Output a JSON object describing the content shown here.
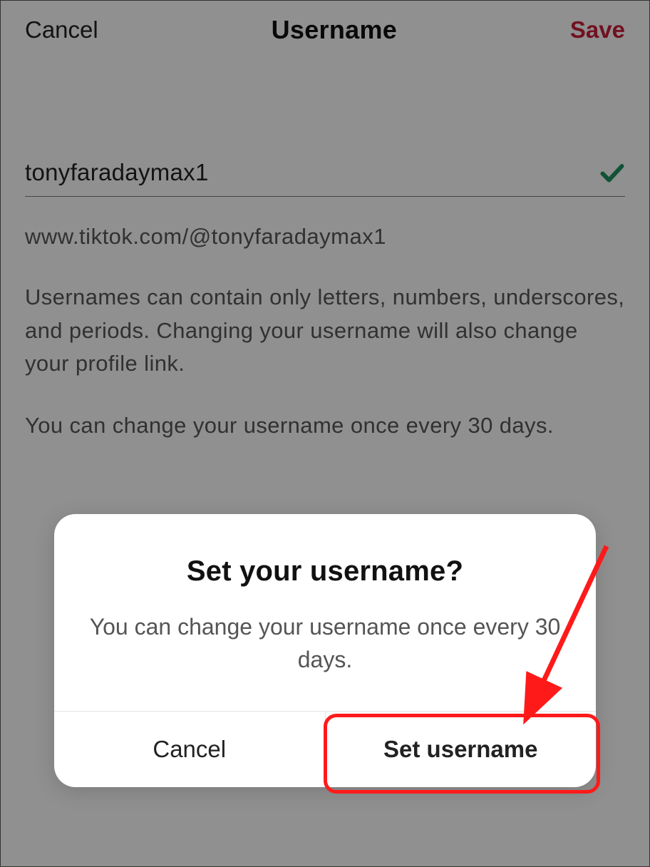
{
  "header": {
    "cancel_label": "Cancel",
    "title": "Username",
    "save_label": "Save"
  },
  "form": {
    "username_value": "tonyfaradaymax1",
    "profile_url": "www.tiktok.com/@tonyfaradaymax1",
    "help_rules": "Usernames can contain only letters, numbers, underscores, and periods. Changing your username will also change your profile link.",
    "help_limit": "You can change your username once every 30 days."
  },
  "dialog": {
    "title": "Set your username?",
    "message": "You can change your username once every 30 days.",
    "cancel_label": "Cancel",
    "confirm_label": "Set username"
  },
  "colors": {
    "accent_red": "#c41e3a",
    "check_green": "#1e8e5e",
    "annotation_red": "#ff1a1a"
  }
}
